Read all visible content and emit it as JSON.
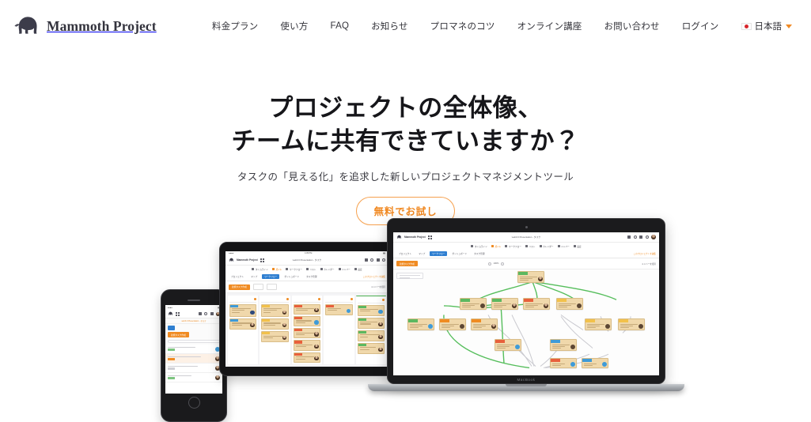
{
  "brand": {
    "name": "Mammoth Project",
    "logo_icon": "mammoth-icon"
  },
  "nav": {
    "items": [
      {
        "label": "料金プラン"
      },
      {
        "label": "使い方"
      },
      {
        "label": "FAQ"
      },
      {
        "label": "お知らせ"
      },
      {
        "label": "プロマネのコツ"
      },
      {
        "label": "オンライン講座"
      },
      {
        "label": "お問い合わせ"
      },
      {
        "label": "ログイン"
      }
    ],
    "language": {
      "label": "日本語",
      "flag_icon": "japan-flag-icon",
      "caret_icon": "chevron-down-icon"
    }
  },
  "hero": {
    "title_line1": "プロジェクトの全体像、",
    "title_line2": "チームに共有できていますか？",
    "subtitle": "タスクの「見える化」を追求した新しいプロジェクトマネジメントツール",
    "cta_label": "無料でお試し"
  },
  "devices": {
    "laptop": {
      "name": "MacBook",
      "label": "MacBook"
    },
    "tablet": {
      "name": "iPad"
    },
    "phone": {
      "name": "iPhone"
    }
  },
  "app": {
    "brand": "Mammoth Project",
    "document_title": "web3.0 Presentation - タスク",
    "menu": [
      {
        "label": "タイムライン",
        "active": false
      },
      {
        "label": "ガント",
        "active": true
      },
      {
        "label": "ワークフロー",
        "active": false
      },
      {
        "label": "リスト",
        "active": false
      },
      {
        "label": "カレンダー",
        "active": false
      },
      {
        "label": "メンバー",
        "active": false
      },
      {
        "label": "設定",
        "active": false
      }
    ],
    "tabs": [
      {
        "label": "プロジェクト",
        "selected": false
      },
      {
        "label": "マップ",
        "selected": false
      },
      {
        "label": "ワークフロー",
        "selected": true
      },
      {
        "label": "ダッシュボード",
        "selected": false
      },
      {
        "label": "タスク管理",
        "selected": false
      }
    ],
    "tabs_right_link": "このプロジェクトを編集",
    "subbar": {
      "primary_button": "新規タスク作成",
      "zoom_level": "100%",
      "right_label": "メンバーを招待"
    },
    "toolbar_icons": [
      "document-icon",
      "search-icon",
      "notification-icon",
      "settings-icon"
    ],
    "avatar_icon": "user-avatar"
  },
  "colors": {
    "accent_orange": "#f08b22",
    "cta_border": "#f6a14e",
    "heading": "#16161a",
    "tab_selected_blue": "#2f7fd1",
    "edge_green": "#4caf50",
    "card_tan": "#f0d8ab"
  }
}
